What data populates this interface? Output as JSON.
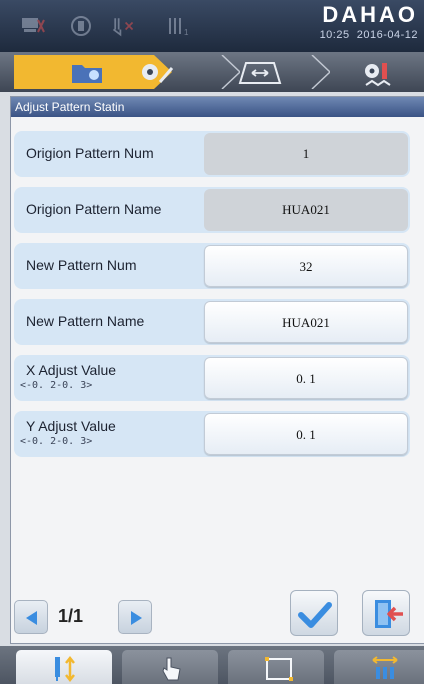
{
  "header": {
    "brand": "DAHAO",
    "time": "10:25",
    "date": "2016-04-12",
    "status_icons": [
      "embroidery-machine-icon",
      "spool-icon",
      "needle-off-icon",
      "needle-1-icon"
    ]
  },
  "steps": [
    "folder-flower-icon",
    "flower-edit-icon",
    "frame-adjust-icon",
    "flower-stitch-icon"
  ],
  "panel": {
    "title": "Adjust Pattern Statin",
    "rows": [
      {
        "label": "Origion Pattern Num",
        "value": "1",
        "editable": false
      },
      {
        "label": "Origion Pattern Name",
        "value": "HUA021",
        "editable": false
      },
      {
        "label": "New Pattern Num",
        "value": "32",
        "editable": true
      },
      {
        "label": "New Pattern Name",
        "value": "HUA021",
        "editable": true
      },
      {
        "label": "X Adjust Value",
        "range": "<-0. 2-0. 3>",
        "value": "0. 1",
        "editable": true
      },
      {
        "label": "Y Adjust Value",
        "range": "<-0. 2-0. 3>",
        "value": "0. 1",
        "editable": true
      }
    ]
  },
  "pager": {
    "page": "1/1"
  },
  "bottom_nav": [
    "needle-updown-icon",
    "hand-pointer-icon",
    "frame-icon",
    "needle-spread-icon"
  ],
  "colors": {
    "accent": "#f2b830",
    "row_bg": "#d6e6f5",
    "check": "#3a8de0"
  }
}
